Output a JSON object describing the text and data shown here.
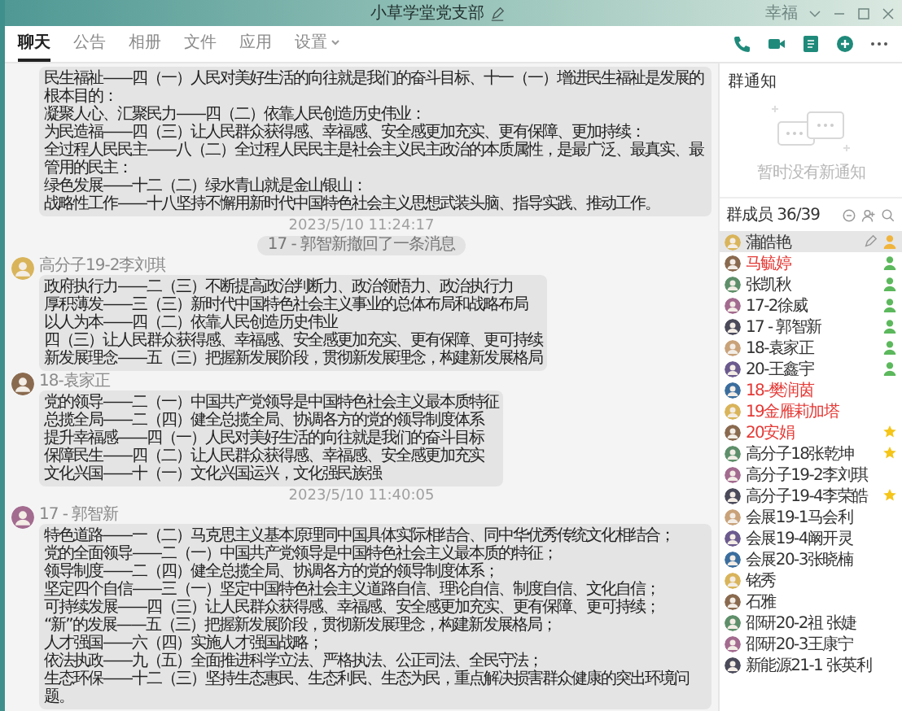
{
  "window": {
    "title": "小草学堂党支部",
    "skin_label": "幸福"
  },
  "tabs": [
    {
      "label": "聊天",
      "selected": true
    },
    {
      "label": "公告",
      "selected": false
    },
    {
      "label": "相册",
      "selected": false
    },
    {
      "label": "文件",
      "selected": false
    },
    {
      "label": "应用",
      "selected": false
    },
    {
      "label": "设置",
      "selected": false,
      "dropdown": true
    }
  ],
  "chat": [
    {
      "kind": "message",
      "lines": [
        "民生福祉——四（一）人民对美好生活的向往就是我们的奋斗目标、十一（一）增进民生福祉是发展的根本目的：",
        "凝聚人心、汇聚民力——四（二）依靠人民创造历史伟业：",
        "为民造福——四（三）让人民群众获得感、幸福感、安全感更加充实、更有保障、更加持续：",
        "全过程人民民主——八（二）全过程人民民主是社会主义民主政治的本质属性，是最广泛、最真实、最管用的民主：",
        "绿色发展——十二（二）绿水青山就是金山银山：",
        "战略性工作——十八坚持不懈用新时代中国特色社会主义思想武装头脑、指导实践、推动工作。"
      ]
    },
    {
      "kind": "time",
      "text": "2023/5/10 11:24:17"
    },
    {
      "kind": "notice",
      "text": "17 - 郭智新撤回了一条消息"
    },
    {
      "kind": "message",
      "author": "高分子19-2李刘琪",
      "lines": [
        "政府执行力——二（三）不断提高政治判断力、政治领悟力、政治执行力",
        "厚积薄发——三（三）新时代中国特色社会主义事业的总体布局和战略布局",
        "以人为本——四（二）依靠人民创造历史伟业",
        "四（三）让人民群众获得感、幸福感、安全感更加充实、更有保障、更可持续",
        "新发展理念——五（三）把握新发展阶段，贯彻新发展理念，构建新发展格局"
      ]
    },
    {
      "kind": "message",
      "author": "18-袁家正",
      "lines": [
        "党的领导——二（一）中国共产党领导是中国特色社会主义最本质特征",
        "总揽全局——二（四）健全总揽全局、协调各方的党的领导制度体系",
        "提升幸福感——四（一）人民对美好生活的向往就是我们的奋斗目标",
        "保障民生——四（二）让人民群众获得感、幸福感、安全感更加充实",
        "文化兴国——十（一）文化兴国运兴，文化强民族强"
      ]
    },
    {
      "kind": "time",
      "text": "2023/5/10 11:40:05"
    },
    {
      "kind": "message",
      "author": "17 - 郭智新",
      "lines": [
        "特色道路——一（二）马克思主义基本原理同中国具体实际相结合、同中华优秀传统文化相结合；",
        "党的全面领导——二（一）中国共产党领导是中国特色社会主义最本质的特征；",
        "领导制度——二（四）健全总揽全局、协调各方的党的领导制度体系；",
        "坚定四个自信——三（一）坚定中国特色社会主义道路自信、理论自信、制度自信、文化自信；",
        "可持续发展——四（三）让人民群众获得感、幸福感、安全感更加充实、更有保障、更可持续；",
        "“新”的发展——五（三）把握新发展阶段，贯彻新发展理念，构建新发展格局；",
        "人才强国——六（四）实施人才强国战略；",
        "依法执政——九（五）全面推进科学立法、严格执法、公正司法、全民守法；",
        "生态环保——十二（三）坚持生态惠民、生态利民、生态为民，重点解决损害群众健康的突出环境问题。"
      ]
    }
  ],
  "notices": {
    "title": "群通知",
    "empty_text": "暂时没有新通知"
  },
  "members": {
    "title": "群成员 36/39",
    "items": [
      {
        "name": "蒲皓艳",
        "color": "#333333",
        "kind": "owner",
        "selected": true
      },
      {
        "name": "马毓婷",
        "color": "#e53935",
        "kind": "admin",
        "selected": false
      },
      {
        "name": "张凯秋",
        "color": "#333333",
        "kind": "admin",
        "selected": false
      },
      {
        "name": "17-2徐威",
        "color": "#333333",
        "kind": "admin",
        "selected": false
      },
      {
        "name": "17 - 郭智新",
        "color": "#333333",
        "kind": "admin",
        "selected": false
      },
      {
        "name": "18-袁家正",
        "color": "#333333",
        "kind": "admin",
        "selected": false
      },
      {
        "name": "20-王鑫宇",
        "color": "#333333",
        "kind": "admin",
        "selected": false
      },
      {
        "name": "18-樊润茵",
        "color": "#e53935",
        "kind": "plain",
        "selected": false
      },
      {
        "name": "19金雁莉加塔",
        "color": "#e53935",
        "kind": "plain",
        "selected": false
      },
      {
        "name": "20安娟",
        "color": "#e53935",
        "kind": "star",
        "selected": false
      },
      {
        "name": "高分子18张乾坤",
        "color": "#333333",
        "kind": "star",
        "selected": false
      },
      {
        "name": "高分子19-2李刘琪",
        "color": "#333333",
        "kind": "plain",
        "selected": false
      },
      {
        "name": "高分子19-4李荣皓",
        "color": "#333333",
        "kind": "star",
        "selected": false
      },
      {
        "name": "会展19-1马会利",
        "color": "#333333",
        "kind": "plain",
        "selected": false
      },
      {
        "name": "会展19-4阚开灵",
        "color": "#333333",
        "kind": "plain",
        "selected": false
      },
      {
        "name": "会展20-3张晓楠",
        "color": "#333333",
        "kind": "plain",
        "selected": false
      },
      {
        "name": "铭秀",
        "color": "#333333",
        "kind": "plain",
        "selected": false
      },
      {
        "name": "石雅",
        "color": "#333333",
        "kind": "plain",
        "selected": false
      },
      {
        "name": "邵研20-2祖 张婕",
        "color": "#333333",
        "kind": "plain",
        "selected": false
      },
      {
        "name": "邵研20-3王康宁",
        "color": "#333333",
        "kind": "plain",
        "selected": false
      },
      {
        "name": "新能源21-1 张英利",
        "color": "#333333",
        "kind": "plain",
        "selected": false
      }
    ]
  }
}
